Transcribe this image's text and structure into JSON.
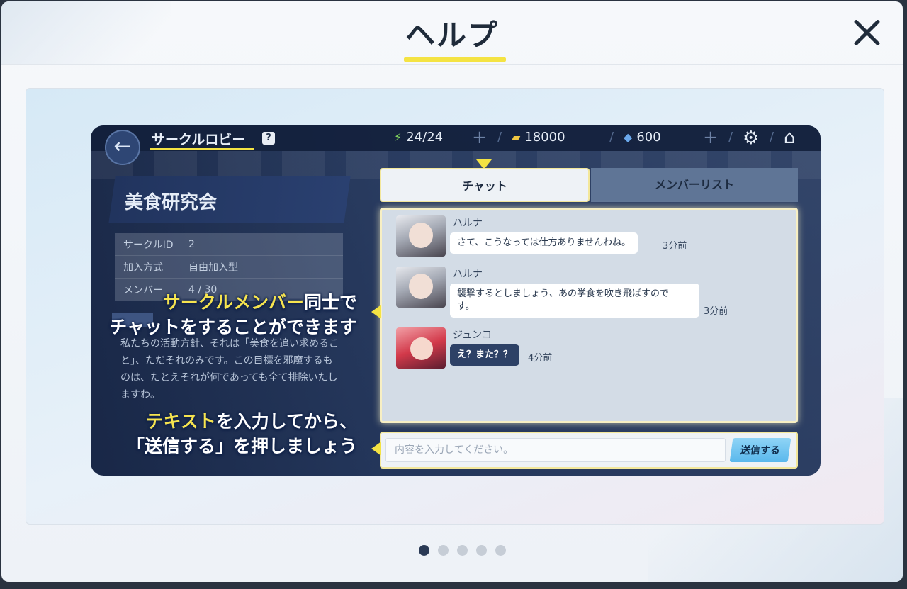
{
  "help": {
    "title": "ヘルプ",
    "close_label": "✕"
  },
  "game": {
    "back_icon": "←",
    "lobby_title": "サークルロビー",
    "question_badge": "?",
    "resources": {
      "ap": "24/24",
      "credits": "18000",
      "gems": "600"
    },
    "club": {
      "name": "美食研究会",
      "info": [
        {
          "key": "サークルID",
          "value": "2"
        },
        {
          "key": "加入方式",
          "value": "自由加入型"
        },
        {
          "key": "メンバー",
          "value": "4 / 30"
        }
      ],
      "description": "私たちの活動方針、それは「美食を追い求めること」、ただそれのみです。この目標を邪魔するものは、たとえそれが何であっても全て排除いたしますわ。"
    },
    "tabs": {
      "chat": "チャット",
      "members": "メンバーリスト"
    },
    "messages": [
      {
        "sender": "ハルナ",
        "text": "さて、こうなっては仕方ありませんわね。",
        "time": "3分前"
      },
      {
        "sender": "ハルナ",
        "text_line1": "襲撃するとしましょう、あの学食を吹き飛ばすので",
        "text_line2": "す。",
        "time": "3分前"
      },
      {
        "sender": "ジュンコ",
        "text": "え？また？？",
        "time": "4分前"
      }
    ],
    "input_placeholder": "内容を入力してください。",
    "send_label": "送信する"
  },
  "callouts": {
    "chat": {
      "line1_highlight": "サークルメンバー",
      "line1_rest": "同士で",
      "line2": "チャットをすることができます"
    },
    "input": {
      "line1_highlight": "テキスト",
      "line1_rest": "を入力してから、",
      "line2": "「送信する」を押しましょう"
    }
  },
  "pagination": {
    "total": 5,
    "current": 1
  },
  "colors": {
    "accent_yellow": "#f4e343",
    "title_text": "#1f2b3a",
    "send_button": "#5ab8ec"
  }
}
